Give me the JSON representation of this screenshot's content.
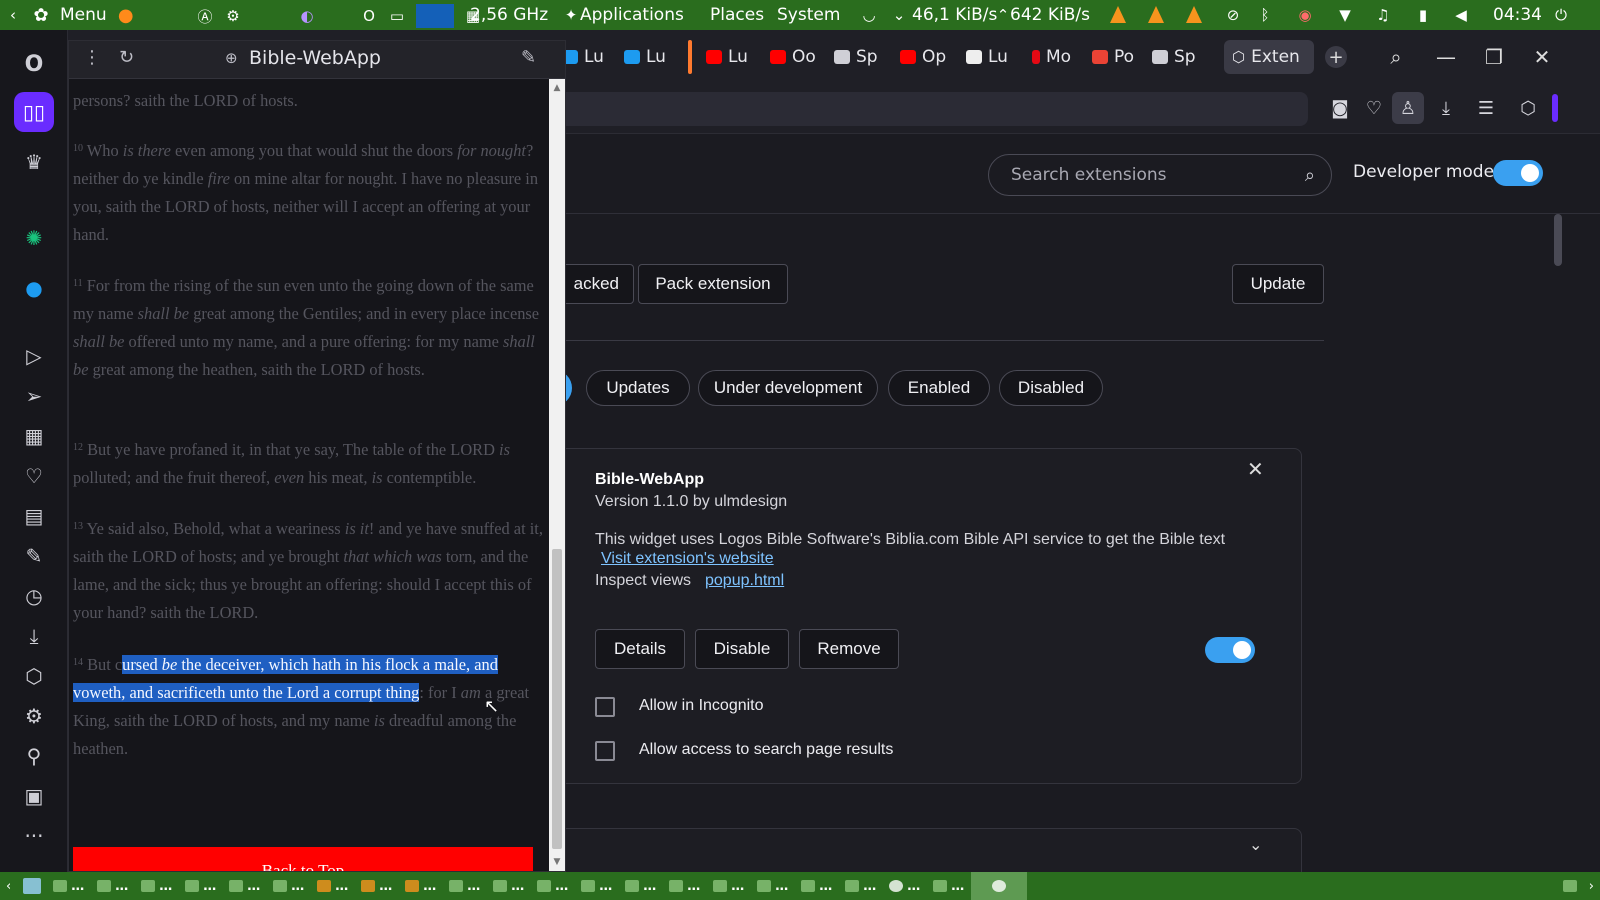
{
  "system_panel": {
    "menu_label": "Menu",
    "cpu_freq": "2,56 GHz",
    "applications": "Applications",
    "places": "Places",
    "system": "System",
    "net_down": "46,1 KiB/s",
    "net_up": "642 KiB/s",
    "clock": "04:34",
    "icons": [
      "menu-icon",
      "firefox-icon",
      "cpu-graph-icon",
      "network-icon",
      "vlc-icon",
      "wifi-icon",
      "battery-icon",
      "volume-icon",
      "power-icon"
    ]
  },
  "tabs": [
    {
      "label": "Lu",
      "favicon": "twitter"
    },
    {
      "label": "Lu",
      "favicon": "twitter"
    },
    {
      "label": "Lu",
      "favicon": "youtube"
    },
    {
      "label": "Oo",
      "favicon": "youtube"
    },
    {
      "label": "Sp",
      "favicon": "grid"
    },
    {
      "label": "Op",
      "favicon": "youtube"
    },
    {
      "label": "Lu",
      "favicon": "doc"
    },
    {
      "label": "Mo",
      "favicon": "netflix"
    },
    {
      "label": "Po",
      "favicon": "gmail"
    },
    {
      "label": "Sp",
      "favicon": "grid"
    },
    {
      "label": "Exten",
      "favicon": "cube"
    }
  ],
  "extensions": {
    "search_placeholder": "Search extensions",
    "developer_mode_label": "Developer mode",
    "developer_mode_on": true,
    "load_unpacked_partial": "acked",
    "pack_extension": "Pack extension",
    "update": "Update",
    "filters": [
      "Updates",
      "Under development",
      "Enabled",
      "Disabled"
    ],
    "card": {
      "name": "Bible-WebApp",
      "version": "Version 1.1.0 by ulmdesign",
      "description": "This widget uses Logos Bible Software's Biblia.com Bible API service to get the Bible text",
      "website_link": "Visit extension's website",
      "inspect_label": "Inspect views",
      "inspect_link": "popup.html",
      "details": "Details",
      "disable": "Disable",
      "remove": "Remove",
      "enabled": true,
      "allow_incognito": "Allow in Incognito",
      "allow_search": "Allow access to search page results"
    }
  },
  "bible_popup": {
    "title": "Bible-WebApp",
    "top_fragment": "persons? saith the LORD of hosts.",
    "back_to_top": "Back to Top"
  },
  "colors": {
    "panel_green": "#2a6d1e",
    "accent_blue": "#3aa0f0",
    "selection": "#1f5fc2",
    "back_to_top_red": "#ff0000",
    "opera_purple": "#6a2cff"
  }
}
